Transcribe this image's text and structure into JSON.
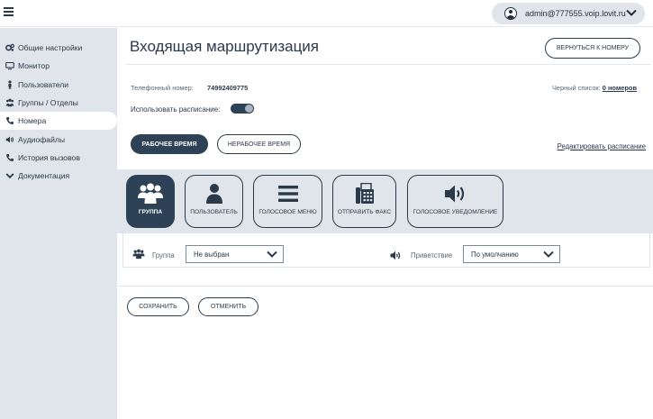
{
  "header": {
    "account_email": "admin@777555.voip.lovit.ru"
  },
  "sidebar": {
    "items": [
      {
        "label": "Общие настройки",
        "icon": "gears-icon"
      },
      {
        "label": "Монитор",
        "icon": "monitor-icon"
      },
      {
        "label": "Пользователи",
        "icon": "user-icon"
      },
      {
        "label": "Группы / Отделы",
        "icon": "group-icon"
      },
      {
        "label": "Номера",
        "icon": "phone-icon",
        "active": true
      },
      {
        "label": "Аудиофайлы",
        "icon": "speaker-icon"
      },
      {
        "label": "История вызовов",
        "icon": "phone-icon"
      },
      {
        "label": "Документация",
        "icon": "chevron-down-icon"
      }
    ]
  },
  "main": {
    "title": "Входящая маршрутизация",
    "back_button": "Вернуться к номеру",
    "phone_label": "Телефонный номер:",
    "phone_value": "74992409775",
    "blacklist_label": "Черный список:",
    "blacklist_value": "0 номеров",
    "schedule_label": "Использовать расписание:",
    "schedule_enabled": true,
    "tab_work": "Рабочее время",
    "tab_nonwork": "Нерабочее время",
    "edit_schedule": "Редактировать расписание",
    "types": [
      {
        "label": "Группа",
        "icon": "group-icon",
        "active": true
      },
      {
        "label": "Пользователь",
        "icon": "user-icon"
      },
      {
        "label": "Голосовое меню",
        "icon": "menu-icon"
      },
      {
        "label": "Отправить факс",
        "icon": "fax-icon"
      },
      {
        "label": "Голосовое уведомление",
        "icon": "speaker-icon"
      }
    ],
    "group_label": "Группа",
    "group_value": "Не выбран",
    "greeting_label": "Приветствие",
    "greeting_value": "По умолчанию",
    "save_button": "Сохранить",
    "cancel_button": "Отменить"
  },
  "colors": {
    "primary": "#2d4256",
    "sidebar_bg": "#dfe5ea",
    "text": "#2b3a4a"
  }
}
